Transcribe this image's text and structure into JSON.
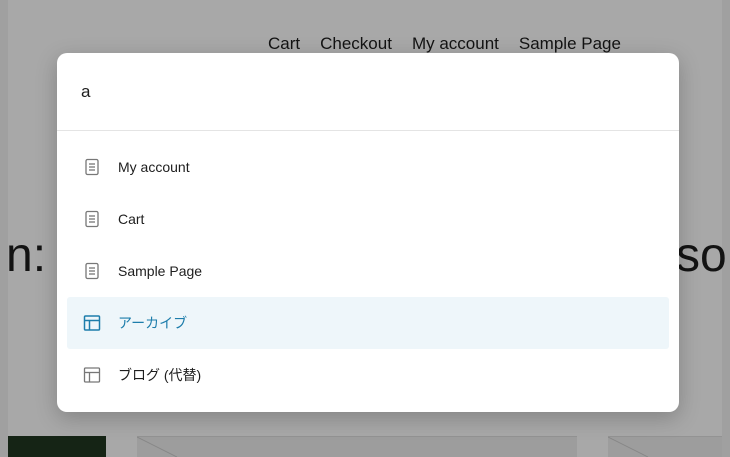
{
  "background": {
    "nav": [
      "Cart",
      "Checkout",
      "My account",
      "Sample Page"
    ],
    "heading_left": "n:",
    "heading_right": "so"
  },
  "palette": {
    "search_value": "a",
    "results": [
      {
        "label": "My account",
        "icon": "page-icon",
        "active": false
      },
      {
        "label": "Cart",
        "icon": "page-icon",
        "active": false
      },
      {
        "label": "Sample Page",
        "icon": "page-icon",
        "active": false
      },
      {
        "label": "アーカイブ",
        "icon": "layout-icon",
        "active": true
      },
      {
        "label": "ブログ (代替)",
        "icon": "layout-icon",
        "active": false
      }
    ]
  },
  "colors": {
    "accent": "#1d7dab",
    "active_bg": "#eef6fa",
    "overlay": "rgba(0,0,0,0.34)"
  }
}
